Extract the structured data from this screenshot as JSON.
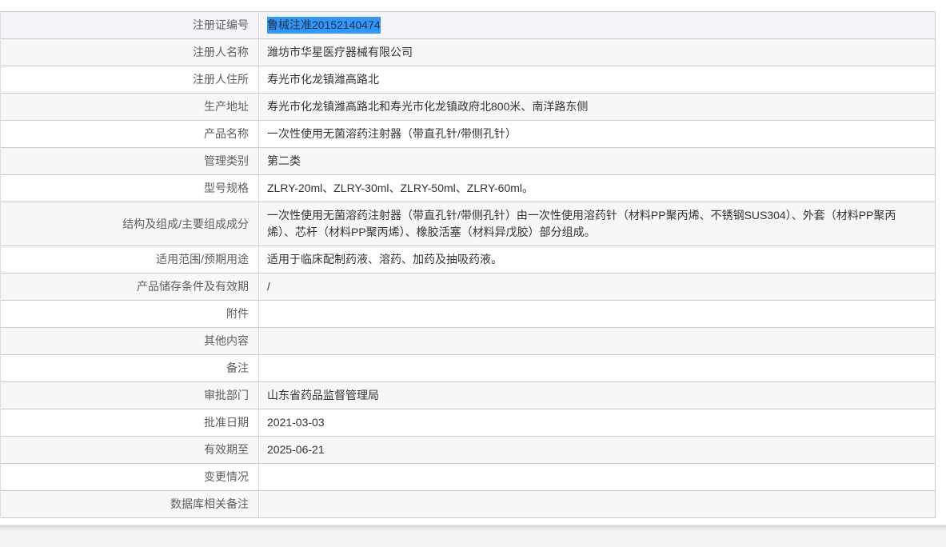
{
  "colors": {
    "selection_highlight": "#3297fd",
    "stripe_gray": "#f7f7f7",
    "hover_row": "#f3f5fb",
    "grid_line": "#cccccc"
  },
  "selection": {
    "selected_text": "鲁械注准20152140474"
  },
  "rows": [
    {
      "label": "注册证编号",
      "value": "鲁械注准20152140474"
    },
    {
      "label": "注册人名称",
      "value": "潍坊市华星医疗器械有限公司"
    },
    {
      "label": "注册人住所",
      "value": "寿光市化龙镇潍高路北"
    },
    {
      "label": "生产地址",
      "value": "寿光市化龙镇潍高路北和寿光市化龙镇政府北800米、南洋路东侧"
    },
    {
      "label": "产品名称",
      "value": "一次性使用无菌溶药注射器（带直孔针/带侧孔针）"
    },
    {
      "label": "管理类别",
      "value": "第二类"
    },
    {
      "label": "型号规格",
      "value": "ZLRY-20ml、ZLRY-30ml、ZLRY-50ml、ZLRY-60ml。"
    },
    {
      "label": "结构及组成/主要组成成分",
      "value": "一次性使用无菌溶药注射器（带直孔针/带侧孔针）由一次性使用溶药针（材料PP聚丙烯、不锈钢SUS304）、外套（材料PP聚丙烯）、芯杆（材料PP聚丙烯）、橡胶活塞（材料异戊胶）部分组成。"
    },
    {
      "label": "适用范围/预期用途",
      "value": "适用于临床配制药液、溶药、加药及抽吸药液。"
    },
    {
      "label": "产品储存条件及有效期",
      "value": "/"
    },
    {
      "label": "附件",
      "value": ""
    },
    {
      "label": "其他内容",
      "value": ""
    },
    {
      "label": "备注",
      "value": ""
    },
    {
      "label": "审批部门",
      "value": "山东省药品监督管理局"
    },
    {
      "label": "批准日期",
      "value": "2021-03-03"
    },
    {
      "label": "有效期至",
      "value": "2025-06-21"
    },
    {
      "label": "变更情况",
      "value": ""
    },
    {
      "label": "数据库相关备注",
      "value": ""
    }
  ]
}
